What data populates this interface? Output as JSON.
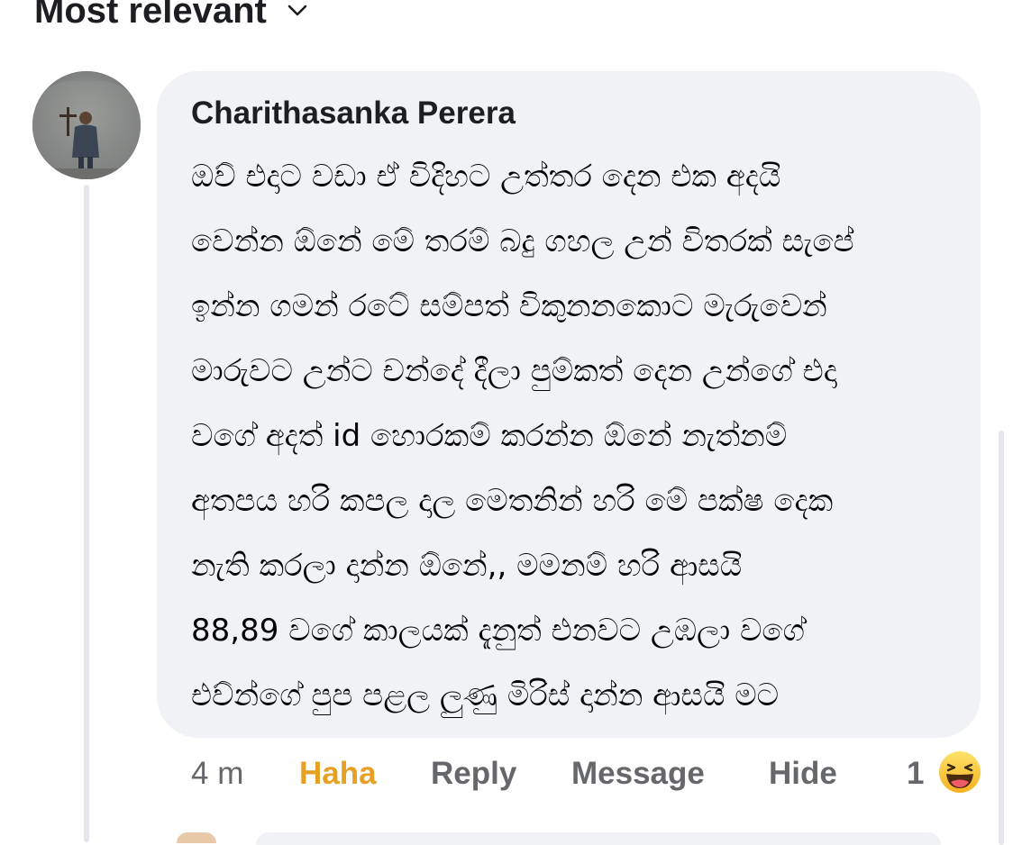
{
  "sort": {
    "label": "Most relevant",
    "icon": "chevron-down-icon"
  },
  "comment": {
    "author": "Charithasanka Perera",
    "lines": [
      "ඔව් එදාට වඩා ඒ විදිහට උත්තර දෙන එක අදයි",
      "වෙන්න ඕනේ මේ තරම් බදු ගහල උන් විතරක් සැපේ",
      "ඉන්න ගමන් රටේ සම්පත් විකුනනකොට මැරුවෙන්",
      "මාරුවට උන්ට චන්දේ දීලා පුම්කත් දෙන උන්ගේ එදා",
      "වගේ අදත් id හොරකම් කරන්න ඕනේ නැත්නම්",
      "අතපය හරි කපල දාල මෙතනින් හරි මේ පක්ෂ දෙක",
      "නැති කරලා දාන්න ඕනේ,, මමනම් හරි ආසයි",
      "88,89 වගේ කාලයක් දැනුත් එනවට උඹලා වගේ",
      "එව්න්ගේ පුප පළල ලුණු මිරිස් දාන්න ආසයි මට"
    ],
    "time": "4 m",
    "actions": {
      "haha": "Haha",
      "reply": "Reply",
      "message": "Message",
      "hide": "Hide"
    },
    "reaction_count": "1",
    "reaction_icon": "haha-emoji-icon",
    "colors": {
      "bubble": "#f0f2f5",
      "haha_active": "#e6a023",
      "action_gray": "#65676b"
    }
  }
}
